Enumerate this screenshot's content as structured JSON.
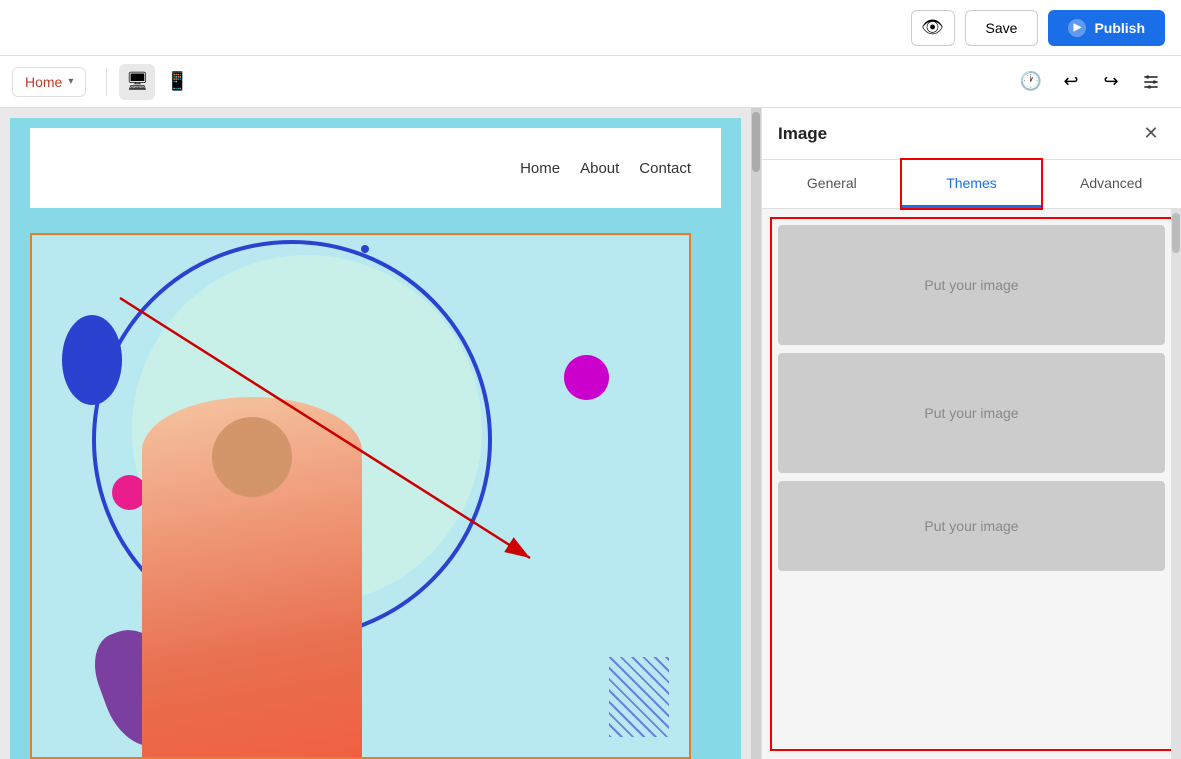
{
  "topbar": {
    "preview_icon": "👁",
    "save_label": "Save",
    "publish_label": "Publish",
    "publish_icon": "▶"
  },
  "toolbar": {
    "home_label": "Home",
    "chevron": "▾",
    "desktop_icon": "🖥",
    "tablet_icon": "📱",
    "history_icon": "🕐",
    "undo_icon": "↩",
    "redo_icon": "↪",
    "settings_icon": "⚙"
  },
  "nav": {
    "links": [
      "Home",
      "About",
      "Contact"
    ]
  },
  "panel": {
    "title": "Image",
    "close_icon": "✕",
    "tabs": [
      {
        "id": "general",
        "label": "General"
      },
      {
        "id": "themes",
        "label": "Themes"
      },
      {
        "id": "advanced",
        "label": "Advanced"
      }
    ],
    "active_tab": "themes",
    "theme_cards": [
      {
        "label": "Put your image"
      },
      {
        "label": "Put your image"
      },
      {
        "label": "Put your image"
      }
    ]
  }
}
